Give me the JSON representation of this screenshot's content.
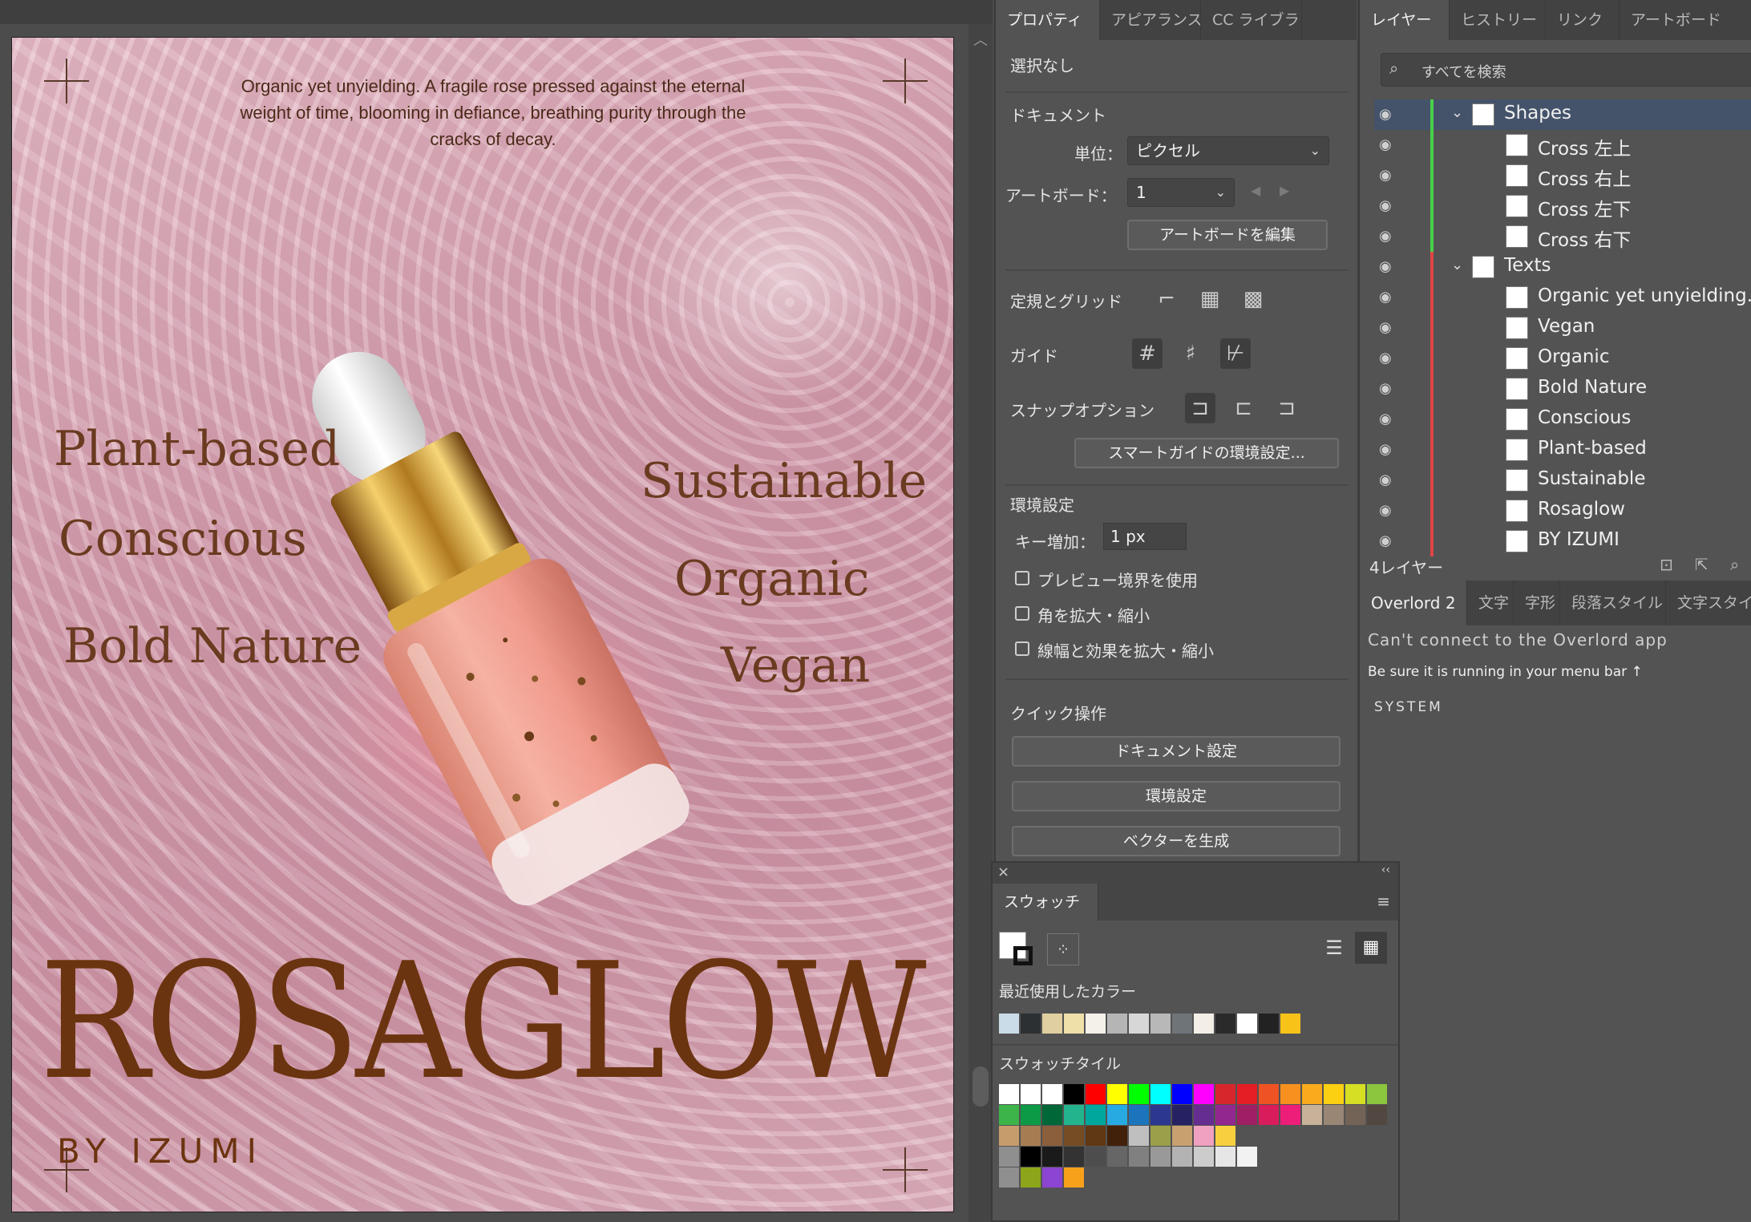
{
  "artboard": {
    "tagline": "Organic yet unyielding. A fragile rose pressed against the eternal weight of time, blooming in defiance, breathing purity through the cracks of decay.",
    "words_left": [
      "Plant-based",
      "Conscious",
      "Bold Nature"
    ],
    "words_right": [
      "Sustainable",
      "Organic",
      "Vegan"
    ],
    "logo": "ROSAGLOW",
    "byline": "BY IZUMI"
  },
  "properties": {
    "tabs": [
      "プロパティ",
      "アピアランス",
      "CC ライブラリ"
    ],
    "selection": "選択なし",
    "document_heading": "ドキュメント",
    "units_label": "単位：",
    "units_value": "ピクセル",
    "artboard_label": "アートボード：",
    "artboard_value": "1",
    "edit_artboard": "アートボードを編集",
    "rulers_grids": "定規とグリッド",
    "guides": "ガイド",
    "snap_options": "スナップオプション",
    "smart_guides_button": "スマートガイドの環境設定...",
    "preferences_heading": "環境設定",
    "key_increment_label": "キー増加：",
    "key_increment_value": "1 px",
    "checkboxes": [
      "プレビュー境界を使用",
      "角を拡大・縮小",
      "線幅と効果を拡大・縮小"
    ],
    "quick_actions_heading": "クイック操作",
    "quick_actions": [
      "ドキュメント設定",
      "環境設定",
      "ベクターを生成"
    ]
  },
  "layers": {
    "tabs": [
      "レイヤー",
      "ヒストリー",
      "リンク",
      "アートボード"
    ],
    "search_placeholder": "すべてを検索",
    "items": [
      {
        "label": "Shapes",
        "level": 0,
        "color": "#47d14a",
        "selected": true
      },
      {
        "label": "Cross 左上",
        "level": 1,
        "color": "#47d14a"
      },
      {
        "label": "Cross 右上",
        "level": 1,
        "color": "#47d14a"
      },
      {
        "label": "Cross 左下",
        "level": 1,
        "color": "#47d14a"
      },
      {
        "label": "Cross 右下",
        "level": 1,
        "color": "#47d14a"
      },
      {
        "label": "Texts",
        "level": 0,
        "color": "#e04545"
      },
      {
        "label": "Organic yet unyielding. A",
        "level": 1,
        "color": "#e04545"
      },
      {
        "label": "Vegan",
        "level": 1,
        "color": "#e04545"
      },
      {
        "label": "Organic",
        "level": 1,
        "color": "#e04545"
      },
      {
        "label": "Bold Nature",
        "level": 1,
        "color": "#e04545"
      },
      {
        "label": "Conscious",
        "level": 1,
        "color": "#e04545"
      },
      {
        "label": "Plant-based",
        "level": 1,
        "color": "#e04545"
      },
      {
        "label": "Sustainable",
        "level": 1,
        "color": "#e04545"
      },
      {
        "label": "Rosaglow",
        "level": 1,
        "color": "#e04545"
      },
      {
        "label": "BY IZUMI",
        "level": 1,
        "color": "#e04545"
      }
    ],
    "count": "4レイヤー"
  },
  "overlord": {
    "tabs": [
      "Overlord 2",
      "文字",
      "字形",
      "段落スタイル",
      "文字スタイ"
    ],
    "message": "Can't connect to the Overlord app",
    "hint": "Be sure it is running in your menu bar ↑",
    "system": "SYSTEM"
  },
  "swatches": {
    "tab": "スウォッチ",
    "recent_heading": "最近使用したカラー",
    "tiles_heading": "スウォッチタイル",
    "recent_colors": [
      "#c9dce8",
      "#2d3033",
      "#e0cfa0",
      "#eee0a8",
      "#f4f1ea",
      "#b5b5b5",
      "#d7d7d7",
      "#b8b8b8",
      "#6f7479",
      "#f3efe7",
      "#2a2a2a",
      "#ffffff",
      "#222222",
      "#f7c318"
    ],
    "tile_rows": [
      [
        "#ffffff",
        "#ffffff",
        "#ffffff",
        "#000000",
        "#ff0000",
        "#ffff00",
        "#00ff00",
        "#00ffff",
        "#0000ff",
        "#ff00ff",
        "#d7262c",
        "#e51e25",
        "#ef5323",
        "#f7901e",
        "#f9aa1d",
        "#fcd012",
        "#d6df23",
        "#8cc63f"
      ],
      [
        "#3cb44a",
        "#0c9a46",
        "#006838",
        "#23b48e",
        "#00a79d",
        "#27aae1",
        "#1c75bc",
        "#2b388f",
        "#262262",
        "#662d91",
        "#92278f",
        "#9e1f63",
        "#d91c5c",
        "#ed1e79",
        "#c7b299",
        "#998675",
        "#736357",
        "#534741"
      ],
      [
        "#c69c6d",
        "#a67c52",
        "#8b5e3c",
        "#754c24",
        "#603813",
        "#42210b",
        "#bfbfbf",
        "#9aa04a",
        "#c8a070",
        "#f0a0c0",
        "#f7d040"
      ],
      [
        "#8f8f8f",
        "#000000",
        "#1a1a1a",
        "#333333",
        "#4d4d4d",
        "#666666",
        "#808080",
        "#999999",
        "#b3b3b3",
        "#cccccc",
        "#e6e6e6",
        "#f2f2f2"
      ],
      [
        "#8f8f8f",
        "#8ca51a",
        "#8c45d0",
        "#f7a11a"
      ]
    ]
  }
}
